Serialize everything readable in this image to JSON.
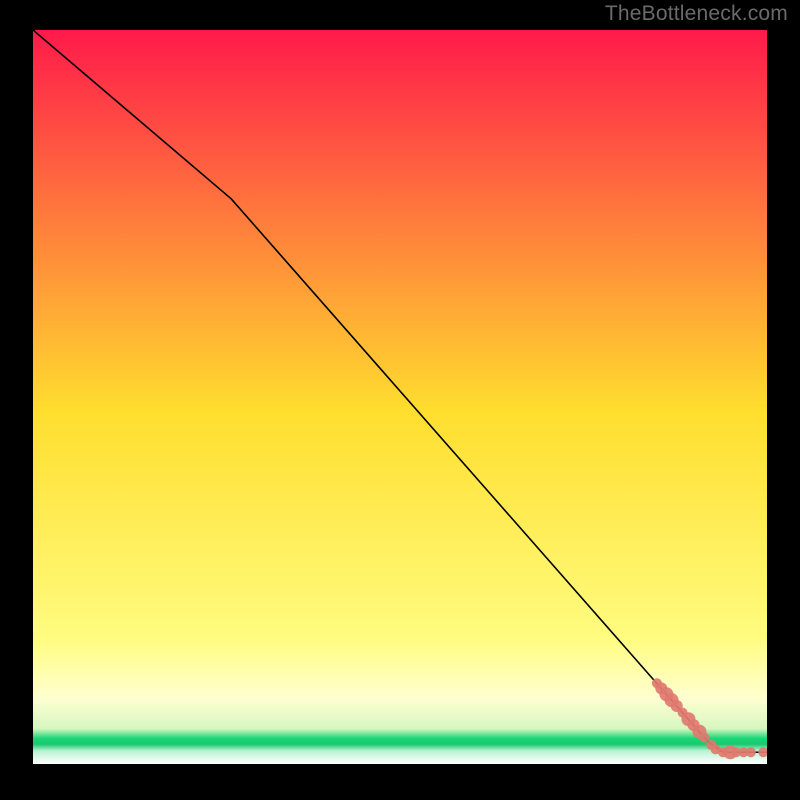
{
  "watermark": "TheBottleneck.com",
  "chart_data": {
    "type": "line",
    "title": "",
    "xlabel": "",
    "ylabel": "",
    "xlim": [
      0,
      100
    ],
    "ylim": [
      0,
      100
    ],
    "gradient_colors": {
      "top": "#ff1a4a",
      "mid": "#ffde2e",
      "low": "#ffffa8",
      "green": "#1ad676",
      "bottom": "#ffffff"
    },
    "line_color": "#000000",
    "marker_color": "#e07a6f",
    "series": [
      {
        "name": "curve",
        "type": "line",
        "points": [
          {
            "x": 0.0,
            "y": 100.0
          },
          {
            "x": 27.0,
            "y": 77.0
          },
          {
            "x": 92.0,
            "y": 3.0
          },
          {
            "x": 94.0,
            "y": 1.6
          },
          {
            "x": 100.0,
            "y": 1.6
          }
        ]
      },
      {
        "name": "markers",
        "type": "scatter",
        "points": [
          {
            "x": 85.0,
            "y": 11.0,
            "r": 1.0
          },
          {
            "x": 85.6,
            "y": 10.3,
            "r": 1.2
          },
          {
            "x": 86.3,
            "y": 9.5,
            "r": 1.4
          },
          {
            "x": 87.0,
            "y": 8.7,
            "r": 1.4
          },
          {
            "x": 87.7,
            "y": 7.9,
            "r": 1.2
          },
          {
            "x": 88.5,
            "y": 7.0,
            "r": 1.0
          },
          {
            "x": 89.3,
            "y": 6.1,
            "r": 1.4
          },
          {
            "x": 90.0,
            "y": 5.3,
            "r": 1.2
          },
          {
            "x": 90.8,
            "y": 4.4,
            "r": 1.4
          },
          {
            "x": 91.5,
            "y": 3.6,
            "r": 1.0
          },
          {
            "x": 92.4,
            "y": 2.6,
            "r": 1.0
          },
          {
            "x": 93.0,
            "y": 2.0,
            "r": 1.0
          },
          {
            "x": 94.0,
            "y": 1.6,
            "r": 1.0
          },
          {
            "x": 95.0,
            "y": 1.6,
            "r": 1.4
          },
          {
            "x": 95.8,
            "y": 1.6,
            "r": 1.0
          },
          {
            "x": 96.8,
            "y": 1.6,
            "r": 1.0
          },
          {
            "x": 97.8,
            "y": 1.6,
            "r": 1.0
          },
          {
            "x": 99.5,
            "y": 1.6,
            "r": 1.0
          }
        ]
      }
    ]
  }
}
